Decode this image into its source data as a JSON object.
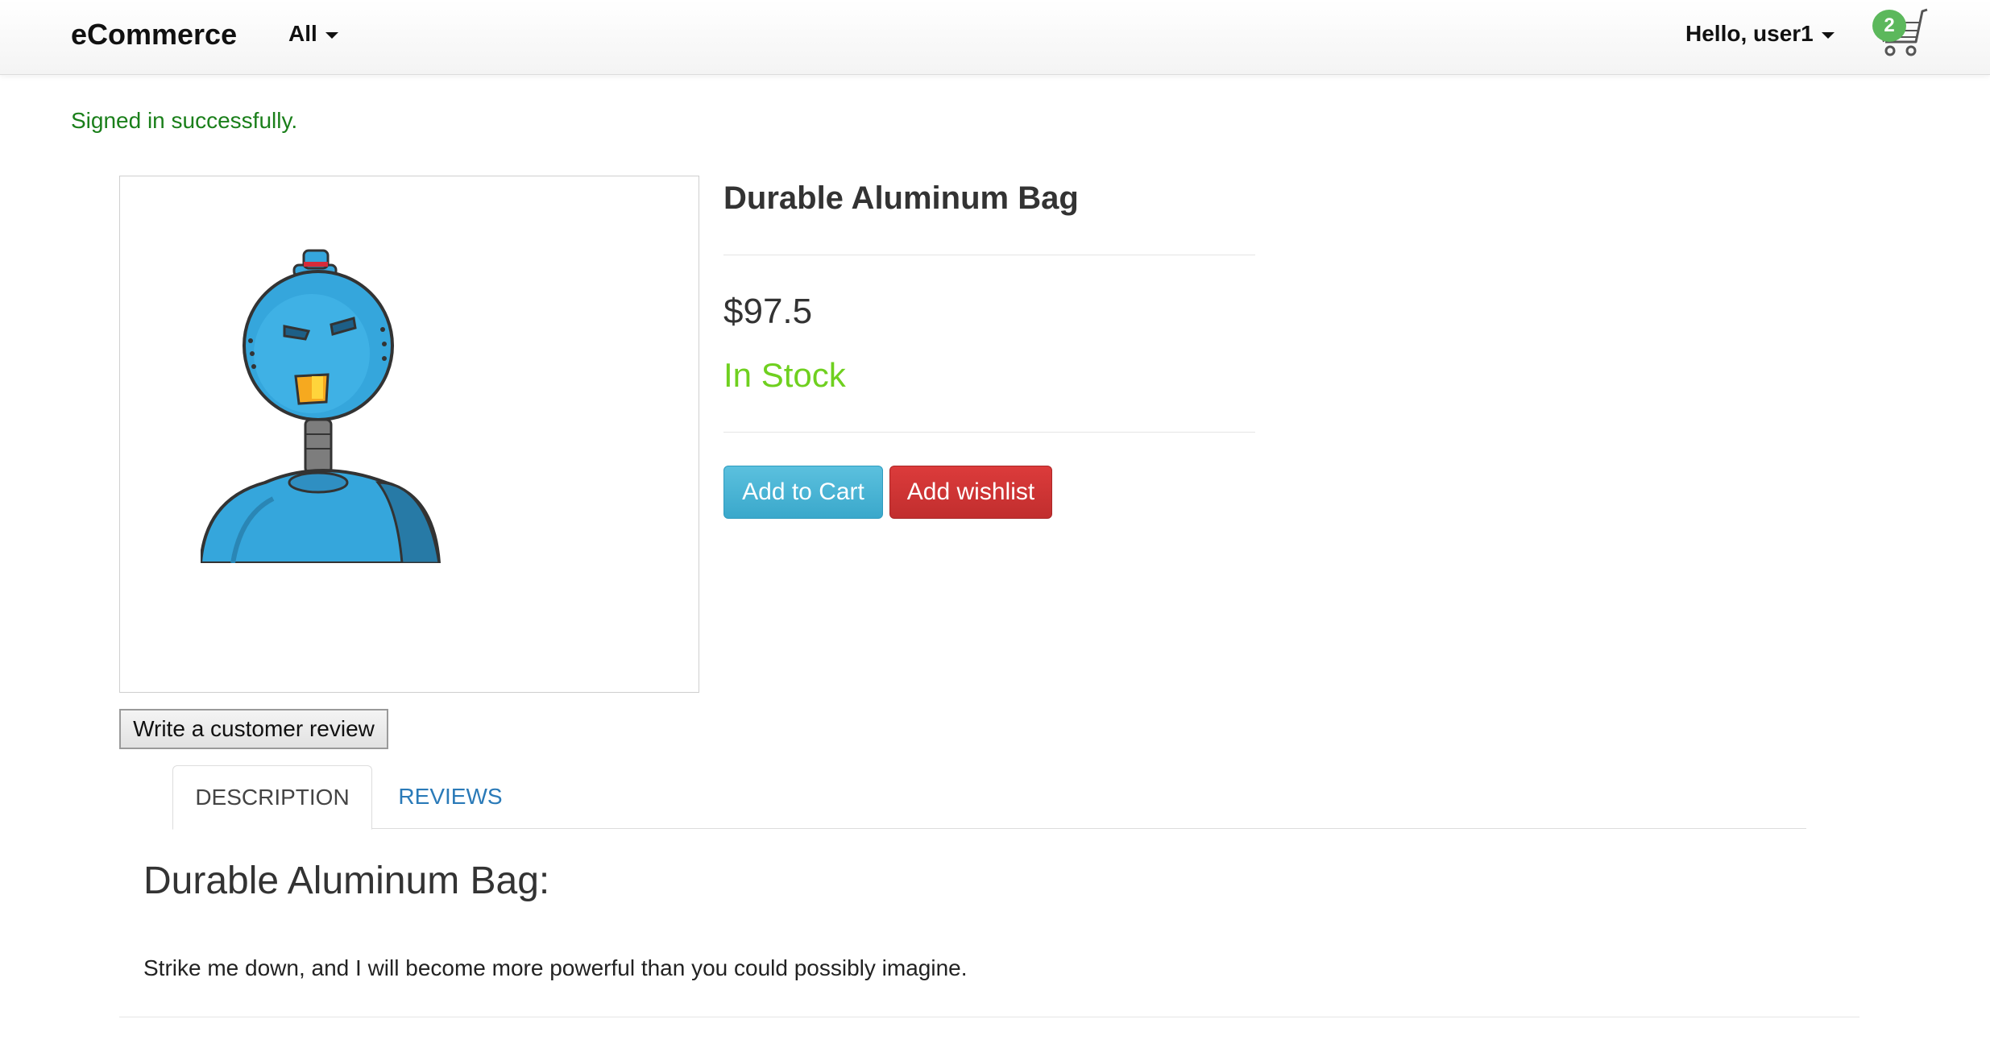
{
  "navbar": {
    "brand": "eCommerce",
    "category_label": "All",
    "user_greeting": "Hello, user1",
    "cart_count": "2"
  },
  "flash": {
    "message": "Signed in successfully."
  },
  "product": {
    "title": "Durable Aluminum Bag",
    "price": "$97.5",
    "stock_status": "In Stock",
    "add_to_cart_label": "Add to Cart",
    "add_wishlist_label": "Add wishlist",
    "write_review_label": "Write a customer review",
    "image_icon": "robot-mascot-image"
  },
  "tabs": [
    {
      "label": "DESCRIPTION",
      "active": true
    },
    {
      "label": "REVIEWS",
      "active": false
    }
  ],
  "description": {
    "heading": "Durable Aluminum Bag:",
    "text": "Strike me down, and I will become more powerful than you could possibly imagine."
  },
  "colors": {
    "in_stock": "#6fd01f",
    "cart_button": "#5bc0de",
    "wishlist_button": "#d9534f",
    "cart_badge": "#5cb85c",
    "flash_text": "#1a7f1a",
    "tab_link": "#2a7ab8"
  }
}
